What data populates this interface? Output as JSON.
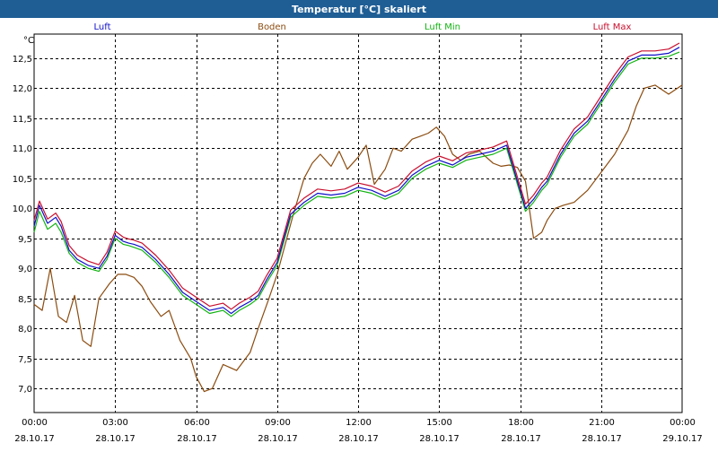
{
  "window": {
    "title": "Temperatur [°C] skaliert"
  },
  "colors": {
    "titlebar": "#1f5e95",
    "luft": "#1010c8",
    "boden": "#8b4c10",
    "luft_min": "#13b413",
    "luft_max": "#c8102e",
    "grid": "#000000"
  },
  "chart_data": {
    "type": "line",
    "title": "Temperatur [°C] skaliert",
    "yunit": "°C",
    "ylim": [
      6.6,
      12.9
    ],
    "xlim": [
      0,
      24
    ],
    "grid": true,
    "legend_placement": "top",
    "yticks": [
      {
        "v": 7.0,
        "label": "7,0"
      },
      {
        "v": 7.5,
        "label": "7,5"
      },
      {
        "v": 8.0,
        "label": "8,0"
      },
      {
        "v": 8.5,
        "label": "8,5"
      },
      {
        "v": 9.0,
        "label": "9,0"
      },
      {
        "v": 9.5,
        "label": "9,5"
      },
      {
        "v": 10.0,
        "label": "10,0"
      },
      {
        "v": 10.5,
        "label": "10,5"
      },
      {
        "v": 11.0,
        "label": "11,0"
      },
      {
        "v": 11.5,
        "label": "11,5"
      },
      {
        "v": 12.0,
        "label": "12,0"
      },
      {
        "v": 12.5,
        "label": "12,5"
      }
    ],
    "xticks": [
      {
        "v": 0,
        "time": "00:00",
        "date": "28.10.17"
      },
      {
        "v": 3,
        "time": "03:00",
        "date": "28.10.17"
      },
      {
        "v": 6,
        "time": "06:00",
        "date": "28.10.17"
      },
      {
        "v": 9,
        "time": "09:00",
        "date": "28.10.17"
      },
      {
        "v": 12,
        "time": "12:00",
        "date": "28.10.17"
      },
      {
        "v": 15,
        "time": "15:00",
        "date": "28.10.17"
      },
      {
        "v": 18,
        "time": "18:00",
        "date": "28.10.17"
      },
      {
        "v": 21,
        "time": "21:00",
        "date": "28.10.17"
      },
      {
        "v": 24,
        "time": "00:00",
        "date": "29.10.17"
      }
    ],
    "series": [
      {
        "name": "Luft",
        "color": "#1010c8",
        "x": [
          0,
          0.2,
          0.5,
          0.8,
          1.0,
          1.3,
          1.6,
          2.0,
          2.4,
          2.7,
          3.0,
          3.3,
          3.5,
          3.7,
          4.0,
          4.5,
          5.0,
          5.5,
          6.0,
          6.5,
          7.0,
          7.3,
          7.6,
          8.0,
          8.3,
          8.6,
          9.0,
          9.5,
          10.0,
          10.5,
          11.0,
          11.5,
          12.0,
          12.5,
          13.0,
          13.5,
          14.0,
          14.5,
          15.0,
          15.5,
          16.0,
          16.5,
          17.0,
          17.5,
          17.8,
          18.2,
          18.5,
          18.8,
          19.0,
          19.5,
          20.0,
          20.5,
          21.0,
          21.5,
          22.0,
          22.5,
          23.0,
          23.5,
          23.9
        ],
        "y": [
          9.7,
          10.05,
          9.75,
          9.85,
          9.7,
          9.3,
          9.15,
          9.05,
          9.0,
          9.2,
          9.55,
          9.45,
          9.42,
          9.4,
          9.35,
          9.15,
          8.9,
          8.6,
          8.45,
          8.3,
          8.35,
          8.25,
          8.35,
          8.45,
          8.55,
          8.8,
          9.1,
          9.9,
          10.1,
          10.25,
          10.22,
          10.25,
          10.35,
          10.3,
          10.2,
          10.3,
          10.55,
          10.7,
          10.8,
          10.72,
          10.85,
          10.9,
          10.95,
          11.05,
          10.6,
          10.0,
          10.15,
          10.35,
          10.45,
          10.9,
          11.25,
          11.45,
          11.8,
          12.15,
          12.45,
          12.55,
          12.55,
          12.58,
          12.68
        ]
      },
      {
        "name": "Boden",
        "color": "#8b4c10",
        "x": [
          0,
          0.3,
          0.6,
          0.9,
          1.2,
          1.5,
          1.8,
          2.1,
          2.4,
          2.8,
          3.1,
          3.4,
          3.7,
          4.0,
          4.3,
          4.7,
          5.0,
          5.4,
          5.8,
          6.0,
          6.3,
          6.6,
          7.0,
          7.5,
          8.0,
          8.3,
          8.7,
          9.0,
          9.3,
          9.6,
          10.0,
          10.3,
          10.6,
          11.0,
          11.3,
          11.6,
          12.0,
          12.3,
          12.6,
          13.0,
          13.3,
          13.6,
          14.0,
          14.3,
          14.6,
          14.9,
          15.2,
          15.5,
          15.8,
          16.1,
          16.5,
          17.0,
          17.3,
          17.6,
          17.9,
          18.2,
          18.5,
          18.8,
          19.0,
          19.3,
          19.6,
          20.0,
          20.5,
          21.0,
          21.5,
          22.0,
          22.3,
          22.6,
          23.0,
          23.5,
          24.0
        ],
        "y": [
          8.4,
          8.3,
          9.0,
          8.2,
          8.1,
          8.55,
          7.8,
          7.7,
          8.5,
          8.75,
          8.9,
          8.9,
          8.85,
          8.7,
          8.45,
          8.2,
          8.3,
          7.8,
          7.5,
          7.2,
          6.95,
          7.0,
          7.4,
          7.3,
          7.6,
          8.0,
          8.5,
          8.9,
          9.4,
          9.9,
          10.5,
          10.75,
          10.9,
          10.7,
          10.95,
          10.65,
          10.85,
          11.05,
          10.4,
          10.65,
          11.0,
          10.95,
          11.15,
          11.2,
          11.25,
          11.35,
          11.2,
          10.9,
          10.8,
          10.9,
          10.95,
          10.75,
          10.7,
          10.72,
          10.68,
          10.45,
          9.5,
          9.6,
          9.8,
          10.0,
          10.05,
          10.1,
          10.3,
          10.6,
          10.9,
          11.3,
          11.7,
          12.0,
          12.05,
          11.9,
          12.05
        ]
      },
      {
        "name": "Luft Min",
        "color": "#13b413",
        "x": [
          0,
          0.2,
          0.5,
          0.8,
          1.0,
          1.3,
          1.6,
          2.0,
          2.4,
          2.7,
          3.0,
          3.3,
          3.5,
          3.7,
          4.0,
          4.5,
          5.0,
          5.5,
          6.0,
          6.5,
          7.0,
          7.3,
          7.6,
          8.0,
          8.3,
          8.6,
          9.0,
          9.5,
          10.0,
          10.5,
          11.0,
          11.5,
          12.0,
          12.5,
          13.0,
          13.5,
          14.0,
          14.5,
          15.0,
          15.5,
          16.0,
          16.5,
          17.0,
          17.5,
          17.8,
          18.2,
          18.5,
          18.8,
          19.0,
          19.5,
          20.0,
          20.5,
          21.0,
          21.5,
          22.0,
          22.5,
          23.0,
          23.5,
          23.9
        ],
        "y": [
          9.6,
          9.95,
          9.65,
          9.75,
          9.6,
          9.25,
          9.1,
          9.0,
          8.95,
          9.15,
          9.5,
          9.4,
          9.38,
          9.35,
          9.3,
          9.1,
          8.85,
          8.55,
          8.4,
          8.25,
          8.3,
          8.2,
          8.3,
          8.4,
          8.5,
          8.75,
          9.05,
          9.85,
          10.05,
          10.2,
          10.17,
          10.2,
          10.3,
          10.25,
          10.15,
          10.25,
          10.5,
          10.65,
          10.75,
          10.68,
          10.8,
          10.85,
          10.9,
          11.0,
          10.55,
          9.95,
          10.1,
          10.3,
          10.4,
          10.85,
          11.2,
          11.4,
          11.75,
          12.1,
          12.4,
          12.5,
          12.5,
          12.53,
          12.6
        ]
      },
      {
        "name": "Luft Max",
        "color": "#c8102e",
        "x": [
          0,
          0.2,
          0.5,
          0.8,
          1.0,
          1.3,
          1.6,
          2.0,
          2.4,
          2.7,
          3.0,
          3.3,
          3.5,
          3.7,
          4.0,
          4.5,
          5.0,
          5.5,
          6.0,
          6.5,
          7.0,
          7.3,
          7.6,
          8.0,
          8.3,
          8.6,
          9.0,
          9.5,
          10.0,
          10.5,
          11.0,
          11.5,
          12.0,
          12.5,
          13.0,
          13.5,
          14.0,
          14.5,
          15.0,
          15.5,
          16.0,
          16.5,
          17.0,
          17.5,
          17.8,
          18.2,
          18.5,
          18.8,
          19.0,
          19.5,
          20.0,
          20.5,
          21.0,
          21.5,
          22.0,
          22.5,
          23.0,
          23.5,
          23.9
        ],
        "y": [
          9.8,
          10.12,
          9.82,
          9.92,
          9.78,
          9.38,
          9.22,
          9.12,
          9.06,
          9.27,
          9.62,
          9.52,
          9.49,
          9.47,
          9.42,
          9.22,
          8.97,
          8.67,
          8.52,
          8.37,
          8.42,
          8.32,
          8.42,
          8.52,
          8.62,
          8.87,
          9.17,
          9.97,
          10.17,
          10.32,
          10.29,
          10.32,
          10.42,
          10.37,
          10.27,
          10.37,
          10.62,
          10.77,
          10.87,
          10.79,
          10.92,
          10.97,
          11.02,
          11.12,
          10.67,
          10.07,
          10.22,
          10.42,
          10.52,
          10.97,
          11.32,
          11.52,
          11.87,
          12.22,
          12.52,
          12.62,
          12.62,
          12.65,
          12.75
        ]
      }
    ]
  }
}
